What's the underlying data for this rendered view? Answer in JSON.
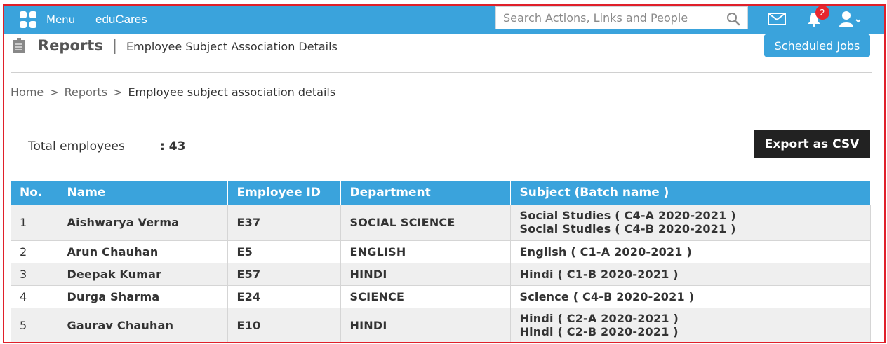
{
  "topbar": {
    "menu_label": "Menu",
    "brand": "eduCares",
    "search_placeholder": "Search Actions, Links and People",
    "notification_count": "2"
  },
  "header": {
    "title": "Reports",
    "separator": "|",
    "subtitle": "Employee Subject Association Details",
    "scheduled_jobs_label": "Scheduled Jobs"
  },
  "breadcrumb": {
    "home": "Home",
    "reports": "Reports",
    "current": "Employee subject association details",
    "separator": ">"
  },
  "summary": {
    "total_label": "Total employees",
    "total_value": ": 43",
    "export_label": "Export as CSV"
  },
  "table": {
    "headers": [
      "No.",
      "Name",
      "Employee ID",
      "Department",
      "Subject (Batch name )"
    ],
    "rows": [
      {
        "no": "1",
        "name": "Aishwarya Verma",
        "id": "E37",
        "dept": "SOCIAL SCIENCE",
        "subjects": [
          "Social Studies ( C4-A 2020-2021 )",
          "Social Studies ( C4-B 2020-2021 )"
        ]
      },
      {
        "no": "2",
        "name": "Arun Chauhan",
        "id": "E5",
        "dept": "ENGLISH",
        "subjects": [
          "English ( C1-A 2020-2021 )"
        ]
      },
      {
        "no": "3",
        "name": "Deepak Kumar",
        "id": "E57",
        "dept": "HINDI",
        "subjects": [
          "Hindi ( C1-B 2020-2021 )"
        ]
      },
      {
        "no": "4",
        "name": "Durga Sharma",
        "id": "E24",
        "dept": "SCIENCE",
        "subjects": [
          "Science ( C4-B 2020-2021 )"
        ]
      },
      {
        "no": "5",
        "name": "Gaurav Chauhan",
        "id": "E10",
        "dept": "HINDI",
        "subjects": [
          "Hindi ( C2-A 2020-2021 )",
          "Hindi ( C2-B 2020-2021 )"
        ]
      }
    ]
  },
  "colors": {
    "primary": "#3aa3dc",
    "dark_button": "#222222",
    "badge": "#e8262d",
    "row_alt": "#efefef"
  },
  "icons": [
    "menu-grid-icon",
    "search-icon",
    "mail-icon",
    "bell-icon",
    "user-icon",
    "reports-icon"
  ]
}
